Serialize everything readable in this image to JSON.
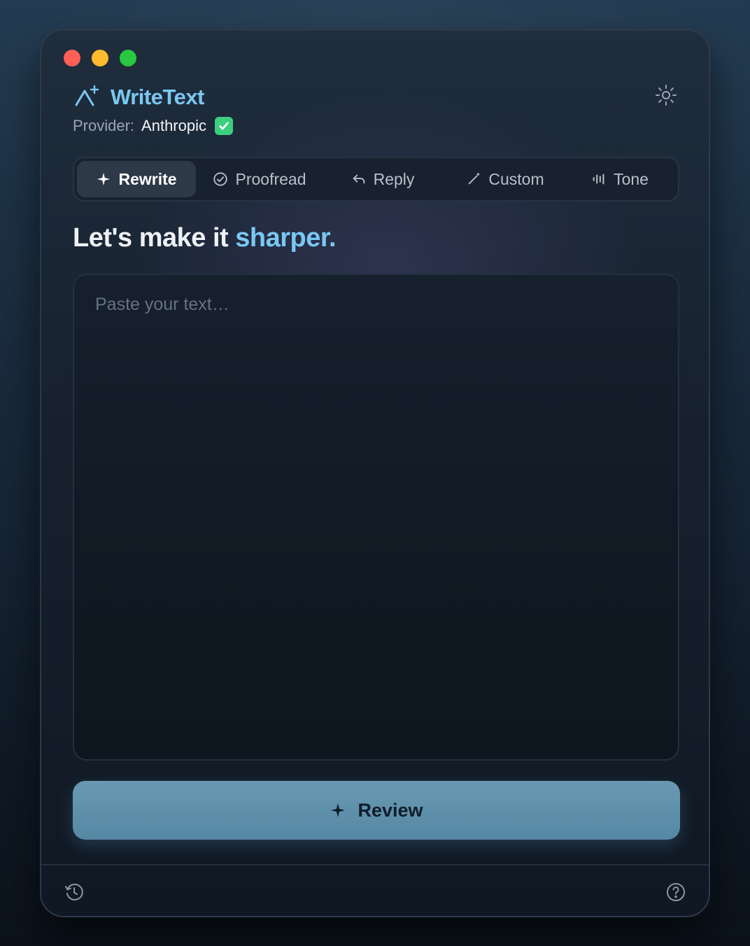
{
  "app": {
    "title": "WriteText",
    "provider_label": "Provider:",
    "provider_name": "Anthropic",
    "provider_verified": true
  },
  "icons": {
    "brand": "pen-sparkle-icon",
    "settings": "sun-gear-icon",
    "history": "history-icon",
    "help": "help-circle-icon"
  },
  "tabs": [
    {
      "label": "Rewrite",
      "icon": "sparkle-icon",
      "active": true
    },
    {
      "label": "Proofread",
      "icon": "check-circle-icon",
      "active": false
    },
    {
      "label": "Reply",
      "icon": "reply-arrow-icon",
      "active": false
    },
    {
      "label": "Custom",
      "icon": "pencil-icon",
      "active": false
    },
    {
      "label": "Tone",
      "icon": "bars-icon",
      "active": false
    }
  ],
  "headline": {
    "prefix": "Let's make it",
    "accent": "sharper."
  },
  "editor": {
    "value": "",
    "placeholder": "Paste your text…"
  },
  "actions": {
    "review_label": "Review"
  },
  "colors": {
    "accent": "#79c8f2",
    "review_button": "#5e91ac",
    "verified": "#3ccf7e"
  }
}
